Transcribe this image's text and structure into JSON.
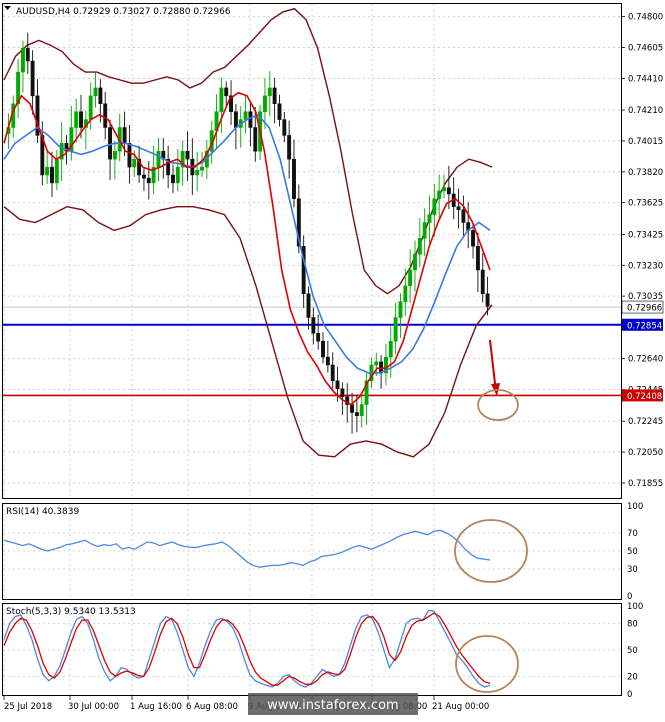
{
  "main_panel": {
    "title": "AUDUSD,H4  0.72929 0.73027 0.72880 0.72966",
    "price_ticks": [
      "0.74800",
      "0.74605",
      "0.74410",
      "0.74210",
      "0.74015",
      "0.73820",
      "0.73625",
      "0.73425",
      "0.73230",
      "0.73035",
      "0.72640",
      "0.72445",
      "0.72245",
      "0.72050",
      "0.71855"
    ],
    "current_price_label": "0.72966",
    "blue_line_label": "0.72854",
    "red_line_label": "0.72408",
    "colors": {
      "candle_up": "#00aa00",
      "candle_down": "#111111",
      "bollinger": "#7a0f0f",
      "ma_fast": "#e00000",
      "ma_slow": "#3a7ae0",
      "hline_blue": "#0000cc",
      "hline_red": "#cc0000",
      "arrow": "#cc0000",
      "circle": "#b5835a"
    }
  },
  "rsi_panel": {
    "title": "RSI(14) 40.3839",
    "ticks": [
      "100",
      "70",
      "50",
      "30",
      "0"
    ],
    "color": "#4a8ae0"
  },
  "stoch_panel": {
    "title": "Stoch(5,3,3) 9.5340 13.5313",
    "ticks": [
      "100",
      "80",
      "50",
      "20",
      "0"
    ],
    "colors": {
      "main": "#4a8ae0",
      "signal": "#e00000"
    }
  },
  "x_axis": {
    "labels": [
      "25 Jul 2018",
      "30 Jul 00:00",
      "1 Aug 16:00",
      "6 Aug 08:00",
      "9 Aug 00:00",
      "13 Aug 16:00",
      "16 Aug 08:00",
      "21 Aug 00:00"
    ]
  },
  "watermark": "www.instaforex.com",
  "chart_data": {
    "type": "line",
    "title": "AUDUSD,H4",
    "ohlc_header": {
      "open": 0.72929,
      "high": 0.73027,
      "low": 0.7288,
      "close": 0.72966
    },
    "ylim": [
      0.7176,
      0.7488
    ],
    "x_count": 122,
    "price": [
      0.741,
      0.7425,
      0.7445,
      0.746,
      0.7452,
      0.743,
      0.7405,
      0.738,
      0.7385,
      0.7375,
      0.739,
      0.74,
      0.7395,
      0.741,
      0.742,
      0.741,
      0.7415,
      0.743,
      0.7435,
      0.7425,
      0.741,
      0.739,
      0.7395,
      0.741,
      0.74,
      0.7385,
      0.739,
      0.738,
      0.7378,
      0.7375,
      0.7385,
      0.7395,
      0.739,
      0.738,
      0.7375,
      0.7385,
      0.7395,
      0.739,
      0.738,
      0.7383,
      0.7385,
      0.7395,
      0.7408,
      0.742,
      0.7435,
      0.743,
      0.742,
      0.741,
      0.7415,
      0.742,
      0.741,
      0.7395,
      0.742,
      0.743,
      0.7435,
      0.7425,
      0.7415,
      0.7405,
      0.739,
      0.7365,
      0.7335,
      0.7305,
      0.729,
      0.728,
      0.7275,
      0.7265,
      0.726,
      0.725,
      0.7245,
      0.724,
      0.7235,
      0.723,
      0.7228,
      0.7235,
      0.725,
      0.726,
      0.7262,
      0.7255,
      0.7265,
      0.7275,
      0.729,
      0.73,
      0.731,
      0.732,
      0.733,
      0.734,
      0.735,
      0.7355,
      0.7365,
      0.737,
      0.7372,
      0.7368,
      0.736,
      0.7358,
      0.735,
      0.7345,
      0.7335,
      0.732,
      0.7305,
      0.7297
    ],
    "bollinger_upper": [
      0.744,
      0.7455,
      0.7462,
      0.7465,
      0.7462,
      0.7458,
      0.745,
      0.7445,
      0.7445,
      0.7442,
      0.744,
      0.7438,
      0.7438,
      0.744,
      0.7442,
      0.744,
      0.7435,
      0.7438,
      0.7445,
      0.7448,
      0.7455,
      0.7462,
      0.747,
      0.7478,
      0.7483,
      0.7485,
      0.7478,
      0.746,
      0.743,
      0.7395,
      0.7355,
      0.732,
      0.731,
      0.7305,
      0.731,
      0.7322,
      0.734,
      0.736,
      0.7375,
      0.7385,
      0.739,
      0.7388,
      0.7385
    ],
    "bollinger_lower": [
      0.736,
      0.7352,
      0.735,
      0.7355,
      0.736,
      0.7358,
      0.735,
      0.7345,
      0.7348,
      0.7355,
      0.7358,
      0.736,
      0.736,
      0.7358,
      0.7355,
      0.734,
      0.731,
      0.7275,
      0.724,
      0.7212,
      0.7203,
      0.7202,
      0.721,
      0.7212,
      0.721,
      0.7205,
      0.7202,
      0.721,
      0.723,
      0.726,
      0.7285,
      0.7298
    ],
    "ma_fast": [
      0.74,
      0.742,
      0.743,
      0.7425,
      0.741,
      0.7395,
      0.739,
      0.7393,
      0.74,
      0.7408,
      0.7415,
      0.7418,
      0.7415,
      0.7405,
      0.7395,
      0.7393,
      0.7385,
      0.7383,
      0.7385,
      0.7388,
      0.739,
      0.7385,
      0.7385,
      0.739,
      0.74,
      0.7415,
      0.7428,
      0.7432,
      0.743,
      0.742,
      0.7395,
      0.736,
      0.732,
      0.7295,
      0.728,
      0.7268,
      0.726,
      0.725,
      0.7243,
      0.7238,
      0.7235,
      0.724,
      0.725,
      0.7258,
      0.7258,
      0.7262,
      0.7275,
      0.7295,
      0.7315,
      0.7335,
      0.735,
      0.7362,
      0.7365,
      0.736,
      0.735,
      0.7335,
      0.732
    ],
    "ma_slow": [
      0.739,
      0.74,
      0.7405,
      0.741,
      0.7405,
      0.7398,
      0.7395,
      0.7393,
      0.7395,
      0.7398,
      0.74,
      0.74,
      0.7398,
      0.7395,
      0.7392,
      0.7388,
      0.7387,
      0.7385,
      0.7388,
      0.7395,
      0.7402,
      0.741,
      0.7415,
      0.7418,
      0.741,
      0.739,
      0.736,
      0.733,
      0.7303,
      0.7285,
      0.7275,
      0.7265,
      0.7258,
      0.7255,
      0.7255,
      0.7258,
      0.7262,
      0.727,
      0.7283,
      0.73,
      0.7318,
      0.7335,
      0.7345,
      0.735,
      0.7345
    ],
    "rsi": [
      62,
      60,
      58,
      56,
      58,
      55,
      52,
      50,
      52,
      54,
      57,
      58,
      60,
      62,
      58,
      55,
      57,
      56,
      58,
      52,
      54,
      52,
      56,
      60,
      59,
      56,
      58,
      60,
      57,
      55,
      54,
      54,
      56,
      57,
      58,
      60,
      56,
      50,
      44,
      38,
      34,
      32,
      33,
      34,
      34,
      35,
      37,
      36,
      34,
      38,
      40,
      44,
      45,
      46,
      48,
      51,
      54,
      56,
      54,
      52,
      55,
      58,
      61,
      65,
      68,
      70,
      72,
      70,
      68,
      72,
      73,
      70,
      66,
      60,
      52,
      46,
      42,
      41,
      40
    ],
    "stoch_main": [
      62,
      80,
      88,
      90,
      78,
      62,
      40,
      22,
      15,
      20,
      32,
      50,
      70,
      85,
      88,
      80,
      62,
      40,
      25,
      15,
      20,
      30,
      28,
      22,
      18,
      20,
      40,
      60,
      80,
      88,
      85,
      70,
      50,
      30,
      20,
      35,
      55,
      72,
      84,
      86,
      82,
      75,
      60,
      40,
      22,
      15,
      12,
      10,
      8,
      12,
      20,
      22,
      15,
      10,
      8,
      12,
      20,
      28,
      24,
      20,
      22,
      35,
      55,
      75,
      88,
      90,
      85,
      70,
      50,
      30,
      40,
      60,
      80,
      85,
      86,
      84,
      95,
      94,
      82,
      70,
      58,
      45,
      38,
      30,
      20,
      12,
      8,
      10
    ],
    "stoch_signal": [
      55,
      70,
      80,
      86,
      84,
      72,
      55,
      35,
      22,
      18,
      25,
      40,
      58,
      75,
      84,
      84,
      72,
      55,
      38,
      25,
      20,
      24,
      26,
      24,
      21,
      20,
      30,
      48,
      68,
      82,
      86,
      80,
      65,
      45,
      30,
      30,
      45,
      62,
      76,
      84,
      84,
      79,
      70,
      55,
      38,
      25,
      18,
      14,
      10,
      10,
      15,
      20,
      18,
      14,
      11,
      11,
      15,
      22,
      25,
      23,
      22,
      28,
      45,
      65,
      80,
      87,
      88,
      80,
      65,
      45,
      38,
      48,
      65,
      78,
      83,
      84,
      88,
      92,
      88,
      78,
      66,
      54,
      44,
      36,
      28,
      20,
      14,
      12
    ]
  }
}
